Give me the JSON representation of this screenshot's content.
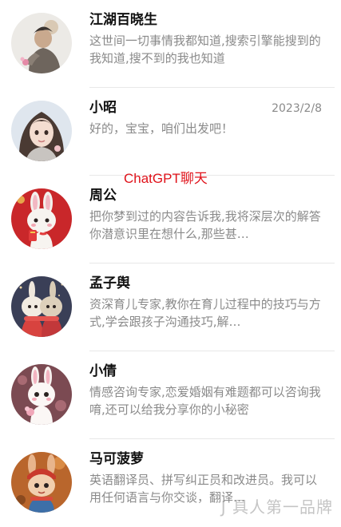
{
  "chats": [
    {
      "name": "江湖百晓生",
      "time": "",
      "preview": "这世间一切事情我都知道,搜索引擎能搜到的我知道,搜不到的我也知道",
      "avatar_icon": "jianghu-character-avatar"
    },
    {
      "name": "小昭",
      "time": "2023/2/8",
      "preview": "好的，宝宝，咱们出发吧！",
      "avatar_icon": "girl-portrait-avatar"
    },
    {
      "name": "周公",
      "time": "",
      "preview": "把你梦到过的内容告诉我,我将深层次的解答你潜意识里在想什么,那些甚…",
      "avatar_icon": "rabbit-red-avatar"
    },
    {
      "name": "孟子舆",
      "time": "",
      "preview": "资深育儿专家,教你在育儿过程中的技巧与方式,学会跟孩子沟通技巧,解…",
      "avatar_icon": "rabbit-pair-avatar"
    },
    {
      "name": "小倩",
      "time": "",
      "preview": "情感咨询专家,恋爱婚姻有难题都可以咨询我唷,还可以给我分享你的小秘密",
      "avatar_icon": "rabbit-pink-avatar"
    },
    {
      "name": "马可菠萝",
      "time": "",
      "preview": "英语翻译员、拼写纠正员和改进员。我可以用任何语言与你交谈，翻译…",
      "avatar_icon": "rabbit-hat-avatar"
    }
  ],
  "overlay_label": "ChatGPT聊天",
  "watermark": "J 具人第一品牌",
  "colors": {
    "name": "#111111",
    "preview": "#8a8a8a",
    "time": "#8a8a8a",
    "divider": "#e8e8e8",
    "overlay_label": "#e0121a"
  }
}
